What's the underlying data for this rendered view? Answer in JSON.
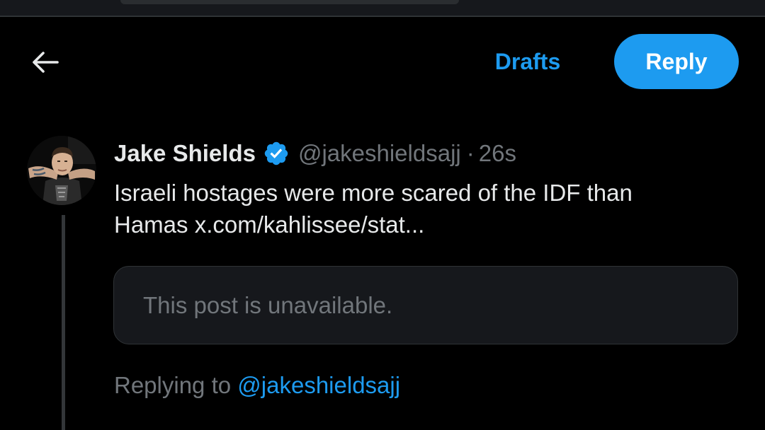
{
  "header": {
    "drafts_label": "Drafts",
    "reply_label": "Reply",
    "back_icon": "arrow-left-icon"
  },
  "tweet": {
    "display_name": "Jake Shields",
    "verified": true,
    "verified_icon": "verified-badge-icon",
    "handle": "@jakeshieldsajj",
    "separator": "·",
    "time": "26s",
    "text_line1": "Israeli hostages were more scared of the IDF than",
    "text_line2": "Hamas x.com/kahlissee/stat..."
  },
  "quote": {
    "unavailable_text": "This post is unavailable."
  },
  "reply_context": {
    "prefix": "Replying to",
    "handle": "@jakeshieldsajj"
  },
  "colors": {
    "background": "#000000",
    "accent": "#1d9bf0",
    "primary_text": "#e7e9ea",
    "secondary_text": "#71767b",
    "card_background": "#16181c",
    "border": "#2f3336"
  }
}
